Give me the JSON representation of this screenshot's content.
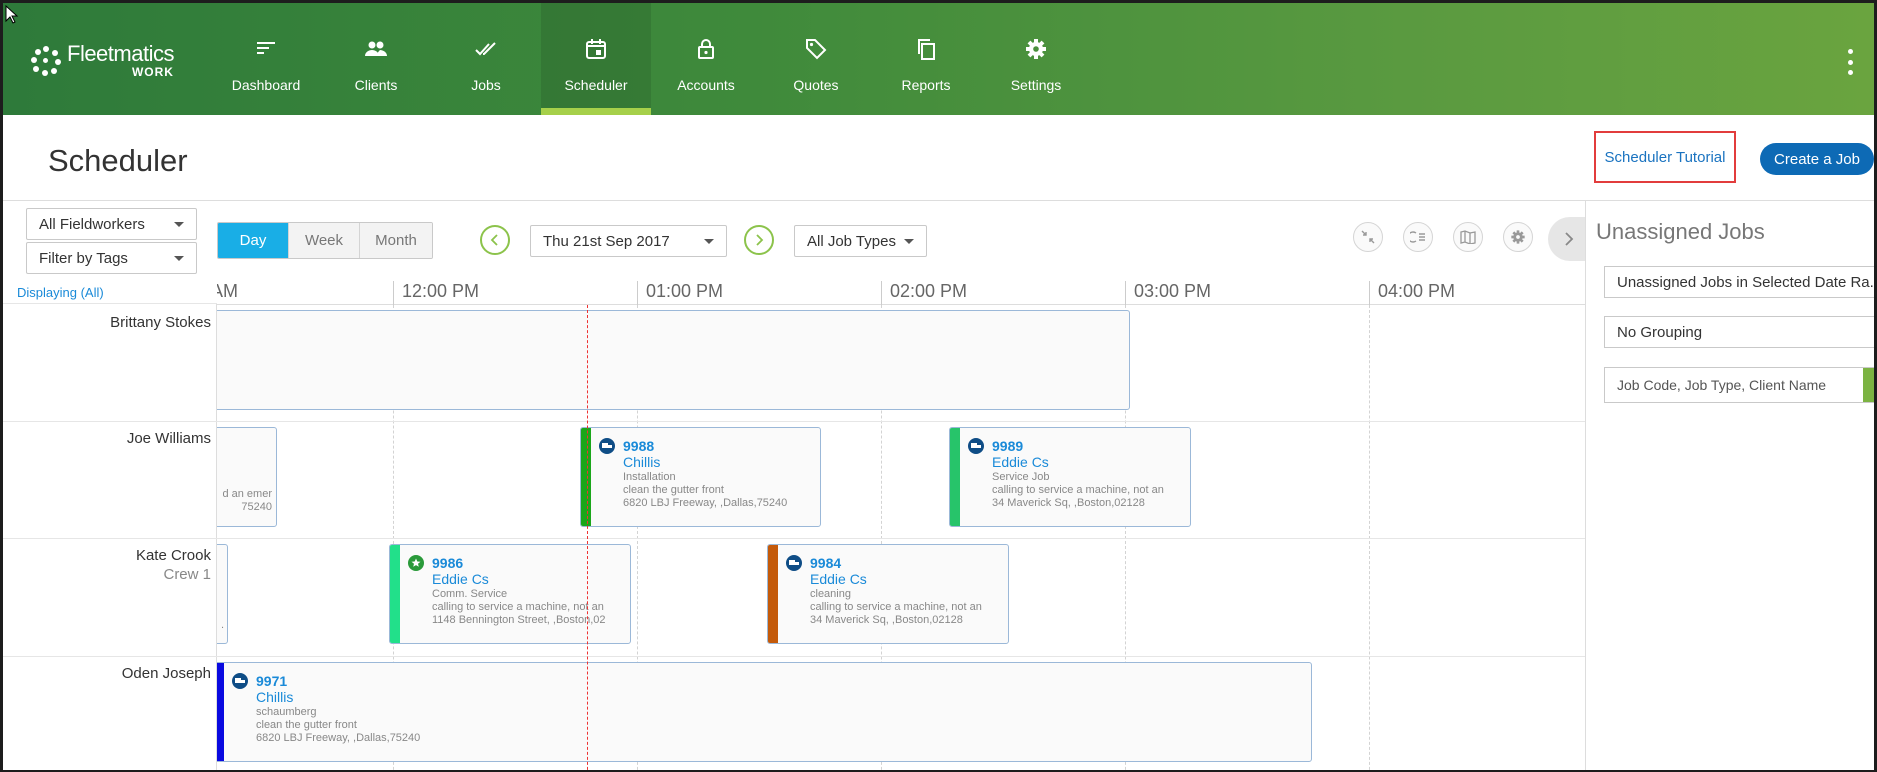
{
  "brand": {
    "line1": "Fleetmatics",
    "line2": "WORK"
  },
  "nav": {
    "items": [
      {
        "label": "Dashboard",
        "icon": "dashboard-icon"
      },
      {
        "label": "Clients",
        "icon": "clients-icon"
      },
      {
        "label": "Jobs",
        "icon": "jobs-icon"
      },
      {
        "label": "Scheduler",
        "icon": "calendar-icon",
        "active": true
      },
      {
        "label": "Accounts",
        "icon": "lock-icon"
      },
      {
        "label": "Quotes",
        "icon": "tag-icon"
      },
      {
        "label": "Reports",
        "icon": "copy-icon"
      },
      {
        "label": "Settings",
        "icon": "gear-icon"
      }
    ]
  },
  "header": {
    "title": "Scheduler",
    "tutorial_label": "Scheduler Tutorial",
    "create_label": "Create a Job"
  },
  "toolbar": {
    "fieldworkers": "All Fieldworkers",
    "tags": "Filter by Tags",
    "views": [
      "Day",
      "Week",
      "Month"
    ],
    "active_view": "Day",
    "date": "Thu 21st Sep 2017",
    "job_types": "All Job Types"
  },
  "displaying": "Displaying (All)",
  "timeline": {
    "hours": [
      "AM",
      "12:00 PM",
      "01:00 PM",
      "02:00 PM",
      "03:00 PM",
      "04:00 PM"
    ]
  },
  "workers": [
    {
      "name": "Brittany Stokes",
      "sub": ""
    },
    {
      "name": "Joe Williams",
      "sub": ""
    },
    {
      "name": "Kate Crook",
      "sub": "Crew 1"
    },
    {
      "name": "Oden Joseph",
      "sub": ""
    }
  ],
  "jobs": {
    "j9988": {
      "code": "9988",
      "client": "Chillis",
      "type": "Installation",
      "desc": "clean the gutter front",
      "addr": "6820 LBJ Freeway, ,Dallas,75240"
    },
    "j9989": {
      "code": "9989",
      "client": "Eddie Cs",
      "type": "Service Job",
      "desc": "calling to service a machine, not an",
      "addr": "34 Maverick Sq, ,Boston,02128"
    },
    "j9986": {
      "code": "9986",
      "client": "Eddie Cs",
      "type": "Comm. Service",
      "desc": "calling to service a machine, not an",
      "addr": "1148 Bennington Street, ,Boston,02"
    },
    "j9984": {
      "code": "9984",
      "client": "Eddie Cs",
      "type": "cleaning",
      "desc": "calling to service a machine, not an",
      "addr": "34 Maverick Sq, ,Boston,02128"
    },
    "j9971": {
      "code": "9971",
      "client": "Chillis",
      "type": "schaumberg",
      "desc": "clean the gutter front",
      "addr": "6820 LBJ Freeway, ,Dallas,75240"
    },
    "partial_joe": {
      "l1": "d an emer",
      "l2": "75240"
    },
    "partial_kate": {
      "l1": "."
    }
  },
  "panel": {
    "title": "Unassigned Jobs",
    "range": "Unassigned Jobs in Selected Date Ra...",
    "grouping": "No Grouping",
    "search_placeholder": "Job Code, Job Type, Client Name"
  },
  "colors": {
    "brand_green": "#3f8a3b",
    "accent_blue": "#0d6ab5",
    "day_active": "#19aee6",
    "stripe_9988": "#1aa61a",
    "stripe_9989": "#27c46a",
    "stripe_9986": "#22e08a",
    "stripe_9984": "#c45a0a",
    "stripe_9971": "#0a0ae0"
  }
}
